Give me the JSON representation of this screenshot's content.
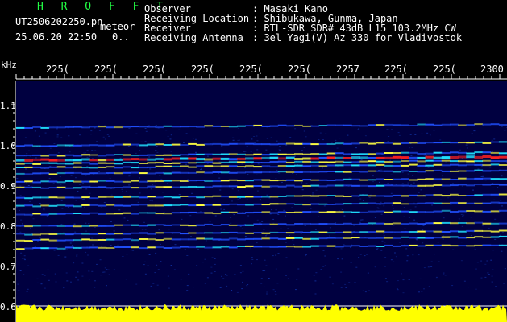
{
  "header": {
    "title": "H R O F F T",
    "filename": "UT2506202250.pn",
    "mode_label": "meteor",
    "datetime": "25.06.20 22:50",
    "extra": "0.."
  },
  "info": {
    "labels": [
      "Observer",
      "Receiving Location",
      "Receiver",
      "Receiving Antenna"
    ],
    "values": [
      ": Masaki Kano",
      ": Shibukawa, Gunma, Japan",
      ": RTL-SDR SDR# 43dB L15 103.2MHz CW",
      ": 3el Yagi(V) Az 330 for Vladivostok"
    ]
  },
  "axes": {
    "y_unit": "kHz",
    "y_ticks": [
      "1.1",
      "1.0",
      "0.9",
      "0.8",
      "0.7",
      "0.6"
    ],
    "x_ticks": [
      "225(",
      "225(",
      "225(",
      "225(",
      "225(",
      "225(",
      "2257",
      "225(",
      "225(",
      "2300"
    ]
  },
  "colors": {
    "background": "#000000",
    "spectrum_bg": "#000040",
    "signal_hot": "#ff2020",
    "signal_mid": "#ffff40",
    "signal_low": "#20e0ff",
    "noise_bar": "#ffff00",
    "grid": "#ffffff"
  },
  "chart_data": {
    "type": "heatmap",
    "y_range_khz": [
      0.6,
      1.1
    ],
    "bands_khz": [
      1.045,
      1.0,
      0.975,
      0.965,
      0.955,
      0.945,
      0.93,
      0.91,
      0.895,
      0.87,
      0.85,
      0.83,
      0.8,
      0.78,
      0.765,
      0.745
    ],
    "band_intensity": [
      0.35,
      0.55,
      0.7,
      1.0,
      0.75,
      0.6,
      0.5,
      0.55,
      0.45,
      0.8,
      0.55,
      0.5,
      0.45,
      0.5,
      0.65,
      0.35
    ],
    "hot_band_khz": 0.965
  }
}
